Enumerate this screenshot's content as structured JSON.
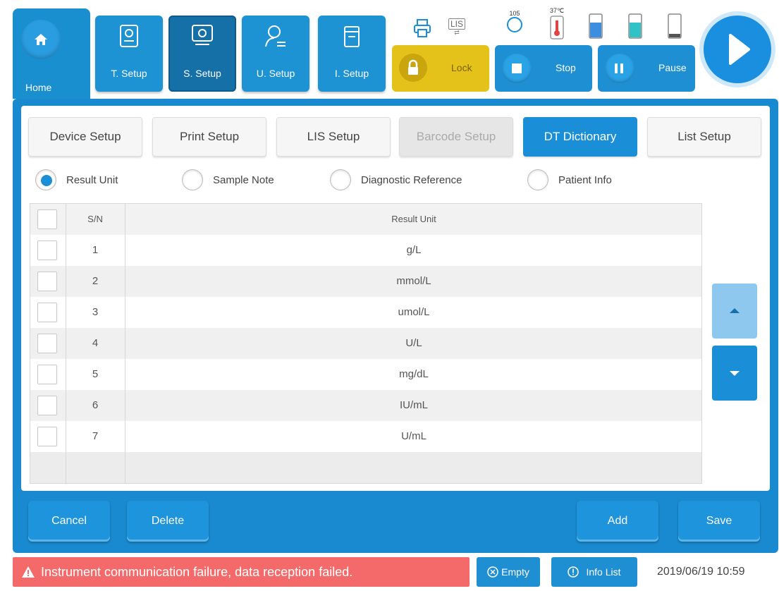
{
  "topbar": {
    "home_label": "Home",
    "nav": [
      {
        "label": "T. Setup"
      },
      {
        "label": "S. Setup"
      },
      {
        "label": "U. Setup"
      },
      {
        "label": "I. Setup"
      }
    ],
    "lock_label": "Lock",
    "stop_label": "Stop",
    "pause_label": "Pause",
    "lis_label": "LIS",
    "counter_value": "105",
    "temperature": "37℃"
  },
  "tabs": [
    {
      "label": "Device Setup"
    },
    {
      "label": "Print Setup"
    },
    {
      "label": "LIS Setup"
    },
    {
      "label": "Barcode Setup"
    },
    {
      "label": "DT Dictionary"
    },
    {
      "label": "List Setup"
    }
  ],
  "radios": [
    {
      "label": "Result Unit"
    },
    {
      "label": "Sample Note"
    },
    {
      "label": "Diagnostic Reference"
    },
    {
      "label": "Patient Info"
    }
  ],
  "table": {
    "headers": {
      "sn": "S/N",
      "unit": "Result Unit"
    },
    "rows": [
      {
        "sn": "1",
        "unit": "g/L"
      },
      {
        "sn": "2",
        "unit": "mmol/L"
      },
      {
        "sn": "3",
        "unit": "umol/L"
      },
      {
        "sn": "4",
        "unit": "U/L"
      },
      {
        "sn": "5",
        "unit": "mg/dL"
      },
      {
        "sn": "6",
        "unit": "IU/mL"
      },
      {
        "sn": "7",
        "unit": "U/mL"
      }
    ]
  },
  "footer": {
    "cancel": "Cancel",
    "delete": "Delete",
    "add": "Add",
    "save": "Save"
  },
  "status": {
    "alarm": "Instrument communication failure, data reception failed.",
    "empty": "Empty",
    "info_list": "Info List",
    "datetime": "2019/06/19 10:59"
  },
  "colors": {
    "accent": "#1a8fd8",
    "lock": "#e5c21a",
    "alarm": "#f46a6a"
  }
}
